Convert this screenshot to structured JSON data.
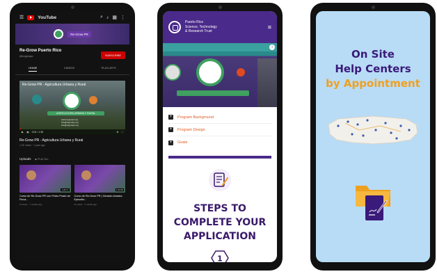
{
  "phone1": {
    "yt_brand": "YouTube",
    "channel_name": "Re-Grow Puerto Rico",
    "channel_handle": "@regrowpr",
    "banner_tag": "Re-Grow PR",
    "subscribe_label": "SUBSCRIBE",
    "tabs": [
      "HOME",
      "VIDEOS",
      "PLAYLISTS"
    ],
    "featured_video": {
      "overlay_title": "Re-Grow PR - Agricultura Urbana y Rural",
      "band_text": "AGRICULTURA URBANA Y RURAL",
      "url_lines": [
        "www.regrowpr.org",
        "info@regrowpr.org",
        "info@regrowpr.org"
      ],
      "time": "0:00 / 1:36",
      "progress": 0.02,
      "title": "Re-Grow PR - Agricultura Urbana y Rural",
      "meta": "1.2K views · 1 year ago"
    },
    "uploads_label": "Uploads",
    "play_all_label": "▶ PLAY ALL",
    "uploads": [
      {
        "title": "Curso de Re-Grow PR con Pedro Prado de Finca...",
        "meta": "13 views · 7 months ago",
        "duration": "1:24:17"
      },
      {
        "title": "Curso de Re-Grow PR | Gerardo Amador, Episodio...",
        "meta": "21 views · 7 months ago",
        "duration": "1:02:05"
      }
    ]
  },
  "phone2": {
    "org_line1": "Puerto Rico",
    "org_line2": "Science, Technology",
    "org_line3": "& Research Trust",
    "hero_badge": "i",
    "accordion": [
      "Program Background",
      "Program Design",
      "Goals"
    ],
    "steps_line1": "STEPS TO",
    "steps_line2": "COMPLETE YOUR",
    "steps_line3": "APPLICATION",
    "step_number": "1"
  },
  "phone3": {
    "title_line1": "On Site",
    "title_line2": "Help Centers",
    "title_line3": "by Appointment"
  },
  "colors": {
    "purple": "#4a2a8a",
    "orange": "#f0a020",
    "accent_orange": "#e05a20",
    "youtube_red": "#cc0000",
    "light_blue": "#b8dcf6"
  }
}
